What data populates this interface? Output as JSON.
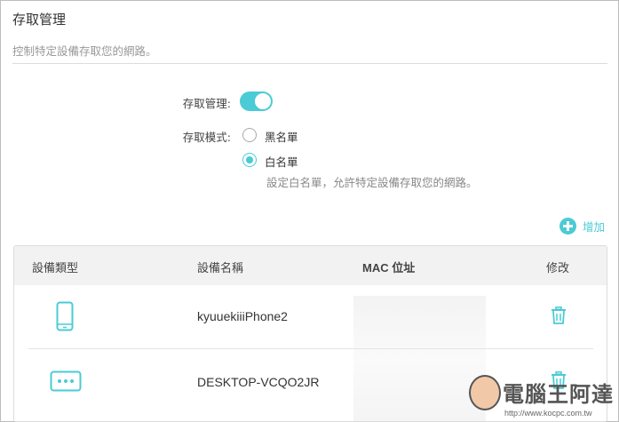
{
  "header": {
    "title": "存取管理",
    "description": "控制特定設備存取您的網路。"
  },
  "settings": {
    "access_control_label": "存取管理:",
    "access_control_enabled": true,
    "access_mode_label": "存取模式:",
    "options": [
      {
        "label": "黑名單",
        "selected": false
      },
      {
        "label": "白名單",
        "selected": true
      }
    ],
    "whitelist_hint": "設定白名單，允許特定設備存取您的網路。"
  },
  "actions": {
    "add_label": "增加"
  },
  "table": {
    "columns": [
      "設備類型",
      "設備名稱",
      "MAC 位址",
      "修改"
    ],
    "rows": [
      {
        "type_icon": "phone-icon",
        "name": "kyuuekiiiPhone2",
        "mac": ""
      },
      {
        "type_icon": "computer-icon",
        "name": "DESKTOP-VCQO2JR",
        "mac": ""
      }
    ]
  },
  "watermark": {
    "text": "電腦王阿達",
    "url": "http://www.kocpc.com.tw"
  },
  "colors": {
    "accent": "#4acbd6",
    "text": "#333333",
    "muted": "#999999",
    "table_header_bg": "#f2f2f2"
  }
}
